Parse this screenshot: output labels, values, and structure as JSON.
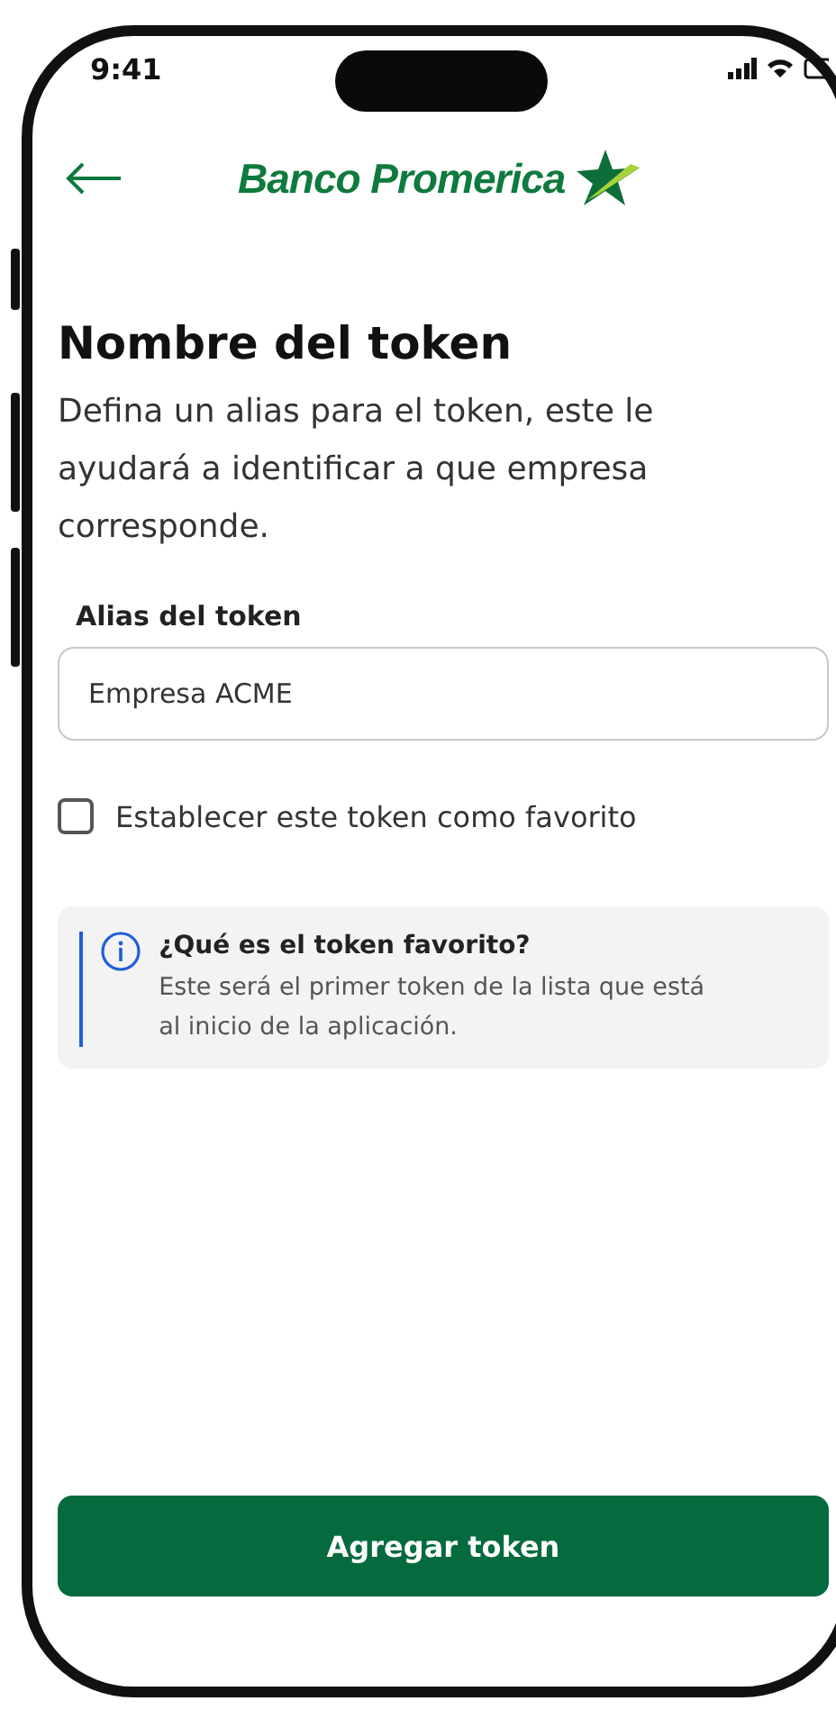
{
  "status_bar": {
    "time": "9:41"
  },
  "header": {
    "brand": "Banco Promerica"
  },
  "title": "Nombre del token",
  "description": "Defina un alias para el token, este le ayudará a identificar a que empresa corresponde.",
  "alias_field": {
    "label": "Alias del token",
    "value": "Empresa ACME"
  },
  "favorite_checkbox": {
    "label": "Establecer este token como favorito",
    "checked": false
  },
  "info": {
    "title": "¿Qué es el token favorito?",
    "text": "Este será el primer token de la lista que está al inicio de la aplicación."
  },
  "primary_button": {
    "label": "Agregar token"
  }
}
